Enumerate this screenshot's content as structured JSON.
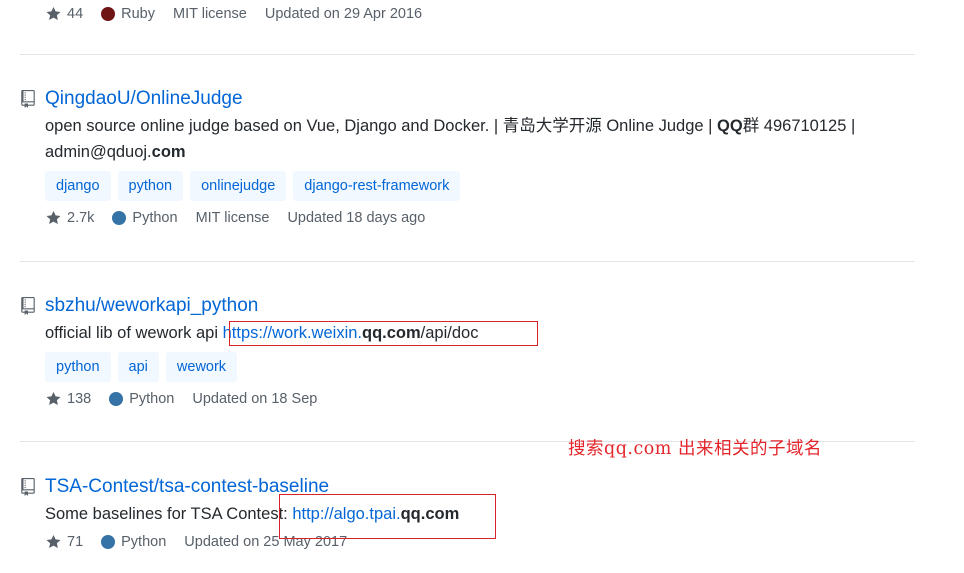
{
  "repos": [
    {
      "stars": "44",
      "language": "Ruby",
      "language_color": "#701516",
      "license": "MIT license",
      "updated": "Updated on 29 Apr 2016"
    },
    {
      "name": "QingdaoU/OnlineJudge",
      "description_line1_a": "open source online judge based on Vue, Django and Docker. | 青岛大学开源 Online Judge | ",
      "description_line1_b": "QQ",
      "description_line1_c": "群 496710125 |",
      "description_line2_a": "admin@qduoj.",
      "description_line2_b": "com",
      "topics": [
        "django",
        "python",
        "onlinejudge",
        "django-rest-framework"
      ],
      "stars": "2.7k",
      "language": "Python",
      "language_color": "#3572A5",
      "license": "MIT license",
      "updated": "Updated 18 days ago"
    },
    {
      "name": "sbzhu/weworkapi_python",
      "description_a": "official lib of wework api ",
      "description_link_a": "https://work.weixin.",
      "description_link_b": "qq.com",
      "description_link_c": "/api/doc",
      "topics": [
        "python",
        "api",
        "wework"
      ],
      "stars": "138",
      "language": "Python",
      "language_color": "#3572A5",
      "updated": "Updated on 18 Sep"
    },
    {
      "name": "TSA-Contest/tsa-contest-baseline",
      "description_a": "Some baselines for TSA Contest: ",
      "description_link_a": "http://algo.tpai.",
      "description_link_b": "qq.com",
      "stars": "71",
      "language": "Python",
      "language_color": "#3572A5",
      "updated": "Updated on 25 May 2017"
    }
  ],
  "annotation": "搜索qq.com 出来相关的子域名",
  "colors": {
    "link": "#0366d6",
    "annotation_red": "#e3262b",
    "topic_bg": "#f1f8ff"
  },
  "icons": {
    "repo": "repo-icon",
    "star": "star-icon"
  }
}
